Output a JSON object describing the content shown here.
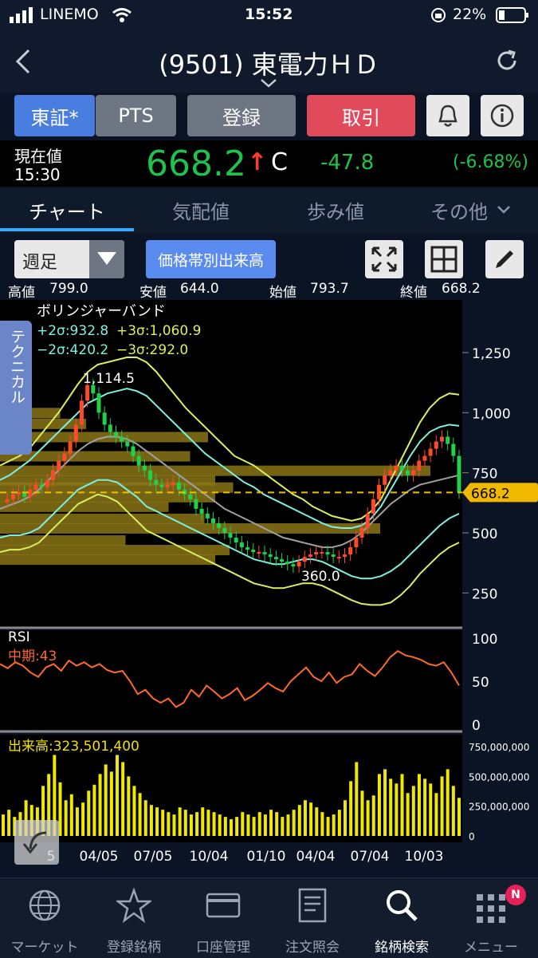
{
  "status_bar": {
    "carrier": "LINEMO",
    "time": "15:52",
    "battery": "22%"
  },
  "header": {
    "title": "(9501) 東電力ＨＤ",
    "back_icon": "back-chevron-icon",
    "refresh_icon": "refresh-icon"
  },
  "buttons": {
    "tosho": "東証*",
    "pts": "PTS",
    "register": "登録",
    "trade": "取引"
  },
  "price": {
    "label": "現在値",
    "time": "15:30",
    "value": "668.2",
    "arrow": "↑",
    "flag": "C",
    "change": "-47.8",
    "change_pct": "(-6.68%)"
  },
  "tabs": [
    {
      "label": "チャート"
    },
    {
      "label": "気配値"
    },
    {
      "label": "歩み値"
    },
    {
      "label": "その他"
    }
  ],
  "controls": {
    "period": "週足",
    "volume_profile": "価格帯別出来高"
  },
  "ohlc": {
    "high_label": "高値",
    "high": "799.0",
    "low_label": "安値",
    "low": "644.0",
    "open_label": "始値",
    "open": "793.7",
    "close_label": "終値",
    "close": "668.2"
  },
  "technical_tab": "テクニカル",
  "chart_data": [
    {
      "type": "candlestick",
      "title": "ボリンジャーバンド",
      "legend": [
        "+2σ:932.8",
        "+3σ:1,060.9",
        "−2σ:420.2",
        "−3σ:292.0"
      ],
      "y_ticks": [
        "1,250",
        "1,000",
        "750",
        "500",
        "250"
      ],
      "ylim": [
        150,
        1450
      ],
      "x_ticks": [
        "5",
        "04/05",
        "07/05",
        "10/04",
        "01/10",
        "04/04",
        "07/04",
        "10/03"
      ],
      "annotations": [
        "1,114.5",
        "360.0"
      ],
      "current_price": "668.2",
      "candles": [
        630,
        640,
        660,
        670,
        650,
        680,
        700,
        690,
        720,
        760,
        800,
        830,
        880,
        950,
        1050,
        1114.5,
        1080,
        1000,
        950,
        920,
        900,
        880,
        860,
        820,
        780,
        760,
        720,
        700,
        690,
        700,
        710,
        680,
        660,
        640,
        600,
        580,
        560,
        540,
        520,
        500,
        480,
        460,
        440,
        430,
        420,
        420,
        410,
        400,
        390,
        380,
        370,
        360,
        380,
        400,
        410,
        420,
        420,
        410,
        400,
        400,
        410,
        440,
        480,
        520,
        580,
        640,
        700,
        740,
        760,
        780,
        760,
        740,
        760,
        800,
        820,
        850,
        880,
        900,
        870,
        820,
        668.2
      ],
      "upper3": [
        780,
        800,
        820,
        850,
        900,
        950,
        1000,
        1060,
        1120,
        1170,
        1200,
        1210,
        1220,
        1230,
        1230,
        1210,
        1170,
        1120,
        1070,
        1020,
        980,
        940,
        900,
        860,
        820,
        800,
        780,
        750,
        720,
        690,
        660,
        640,
        610,
        590,
        570,
        560,
        550,
        560,
        590,
        640,
        720,
        800,
        880,
        960,
        1020,
        1060,
        1080,
        1075
      ],
      "upper2": [
        720,
        740,
        770,
        800,
        840,
        880,
        920,
        960,
        1000,
        1040,
        1060,
        1080,
        1090,
        1100,
        1090,
        1070,
        1030,
        990,
        950,
        910,
        870,
        830,
        800,
        770,
        740,
        710,
        690,
        660,
        640,
        620,
        600,
        580,
        560,
        540,
        525,
        520,
        520,
        530,
        560,
        610,
        680,
        750,
        820,
        880,
        920,
        940,
        950,
        945
      ],
      "middle": [
        600,
        615,
        630,
        650,
        680,
        720,
        760,
        800,
        840,
        870,
        890,
        900,
        900,
        890,
        870,
        840,
        810,
        780,
        750,
        720,
        690,
        660,
        630,
        600,
        580,
        560,
        540,
        520,
        500,
        480,
        470,
        460,
        450,
        440,
        440,
        450,
        470,
        500,
        540,
        580,
        620,
        650,
        680,
        700,
        710,
        720,
        730,
        740
      ],
      "lower2": [
        480,
        490,
        490,
        500,
        520,
        560,
        600,
        640,
        680,
        700,
        720,
        720,
        710,
        680,
        650,
        610,
        590,
        570,
        550,
        530,
        510,
        490,
        470,
        450,
        430,
        410,
        390,
        380,
        370,
        370,
        380,
        390,
        390,
        380,
        360,
        340,
        320,
        310,
        310,
        320,
        340,
        370,
        410,
        450,
        490,
        530,
        560,
        580
      ],
      "lower3": [
        420,
        430,
        430,
        440,
        460,
        500,
        540,
        580,
        620,
        640,
        660,
        650,
        630,
        590,
        550,
        510,
        490,
        470,
        450,
        430,
        410,
        390,
        370,
        350,
        330,
        310,
        290,
        280,
        270,
        270,
        280,
        290,
        290,
        280,
        260,
        240,
        220,
        205,
        200,
        200,
        210,
        240,
        280,
        330,
        370,
        410,
        440,
        460
      ],
      "volume_profile": [
        [
          "1,114.5",
          0
        ],
        [
          1000,
          84
        ],
        [
          955,
          120
        ],
        [
          900,
          290
        ],
        [
          820,
          265
        ],
        [
          760,
          600
        ],
        [
          720,
          300
        ],
        [
          690,
          325
        ],
        [
          650,
          300
        ],
        [
          610,
          235
        ],
        [
          560,
          285
        ],
        [
          520,
          530
        ],
        [
          470,
          175
        ],
        [
          430,
          320
        ],
        [
          390,
          300
        ]
      ]
    },
    {
      "type": "line",
      "title": "RSI",
      "legend": [
        "中期:43"
      ],
      "y_ticks": [
        "100",
        "50",
        "0"
      ],
      "ylim": [
        0,
        100
      ],
      "values": [
        70,
        65,
        72,
        68,
        60,
        55,
        66,
        70,
        62,
        74,
        68,
        72,
        66,
        70,
        63,
        60,
        62,
        50,
        35,
        40,
        30,
        25,
        30,
        20,
        25,
        40,
        32,
        45,
        38,
        30,
        35,
        42,
        28,
        33,
        40,
        48,
        42,
        38,
        50,
        58,
        66,
        55,
        50,
        60,
        48,
        55,
        58,
        70,
        62,
        56,
        66,
        78,
        85,
        80,
        78,
        75,
        70,
        68,
        72,
        60,
        45
      ]
    },
    {
      "type": "bar",
      "title": "出来高:323,501,400",
      "y_ticks": [
        "750,000,000",
        "500,000,000",
        "250,000,000",
        "0"
      ],
      "ylim": [
        0,
        800000000
      ],
      "values": [
        180,
        220,
        160,
        200,
        300,
        260,
        240,
        420,
        520,
        680,
        450,
        300,
        350,
        240,
        280,
        380,
        430,
        520,
        600,
        540,
        680,
        620,
        500,
        420,
        360,
        300,
        260,
        240,
        220,
        200,
        180,
        240,
        220,
        180,
        200,
        240,
        220,
        200,
        180,
        160,
        140,
        160,
        200,
        180,
        160,
        200,
        180,
        220,
        200,
        160,
        180,
        220,
        260,
        300,
        280,
        240,
        200,
        160,
        180,
        220,
        300,
        460,
        620,
        380,
        300,
        340,
        520,
        560,
        480,
        440,
        520,
        360,
        420,
        520,
        480,
        440,
        360,
        500,
        560,
        420,
        320
      ]
    }
  ],
  "nav": [
    {
      "label": "マーケット",
      "icon": "globe-icon"
    },
    {
      "label": "登録銘柄",
      "icon": "star-icon"
    },
    {
      "label": "口座管理",
      "icon": "card-icon"
    },
    {
      "label": "注文照会",
      "icon": "document-icon"
    },
    {
      "label": "銘柄検索",
      "icon": "search-icon"
    },
    {
      "label": "メニュー",
      "icon": "grid-icon",
      "badge": "N"
    }
  ],
  "colors": {
    "accent_blue": "#4a7de0",
    "trade_red": "#e04a5a",
    "up_green": "#1fc24a",
    "down_red": "#e03a2a",
    "price_tag": "#f0b800"
  }
}
